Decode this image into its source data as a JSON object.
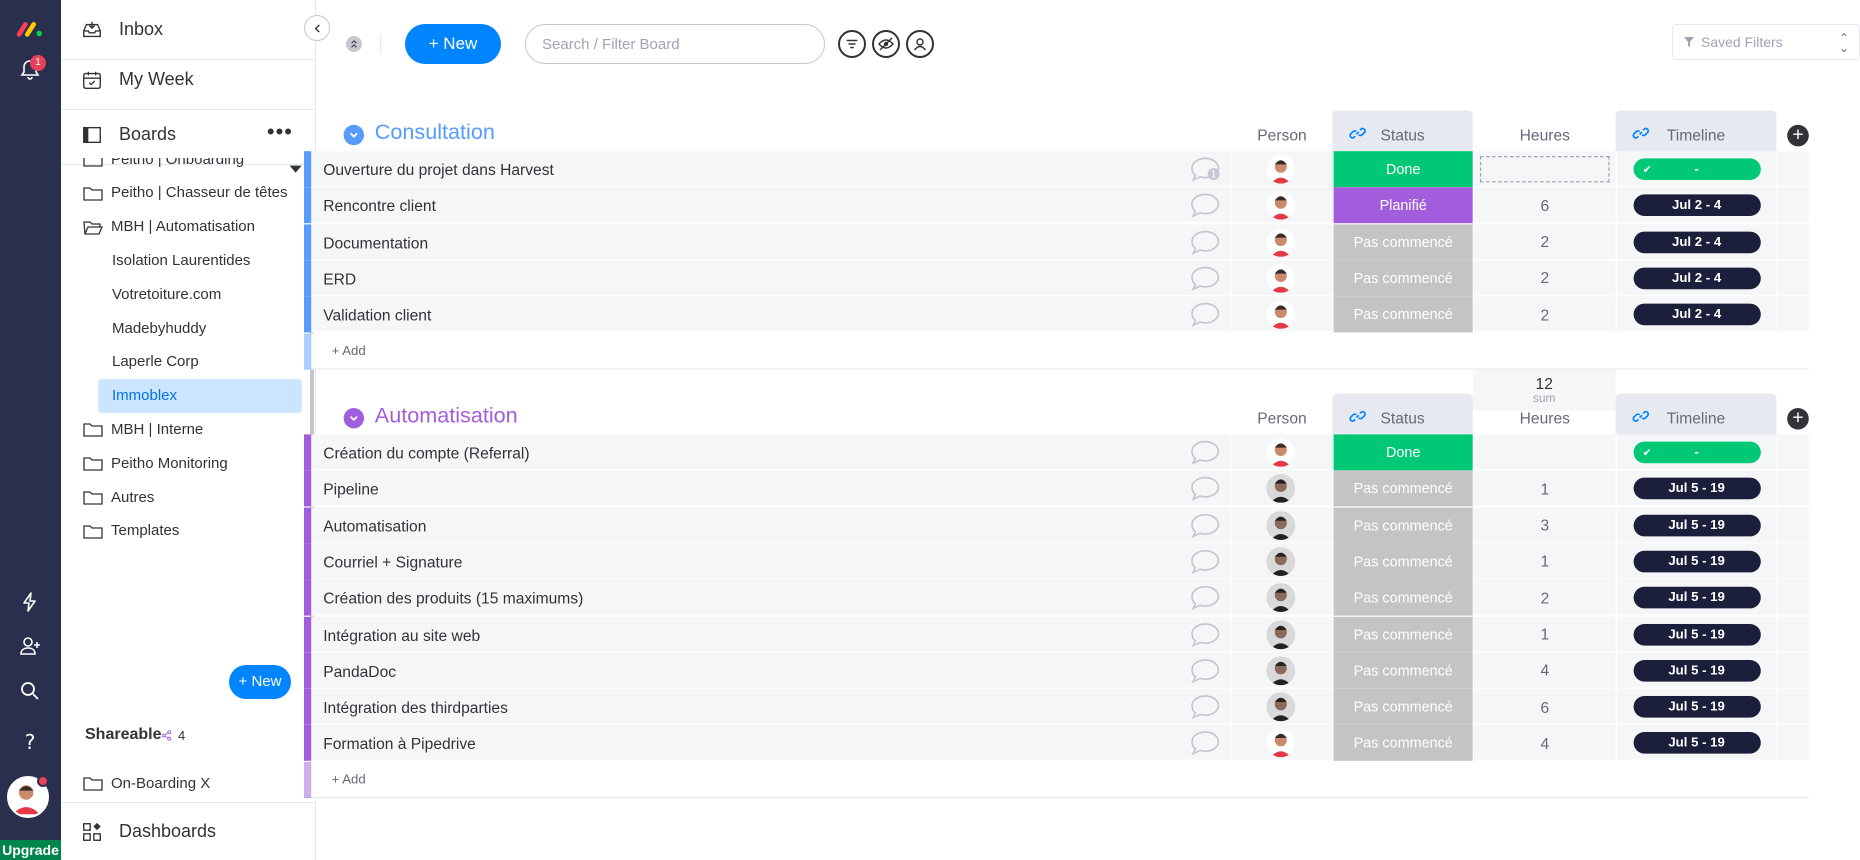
{
  "colors": {
    "consultation": "#579bfc",
    "automatisation": "#a25ddc",
    "done": "#00c875",
    "planifie": "#a25ddc",
    "pas_commence": "#c4c4c4"
  },
  "rail": {
    "notification_count": "1",
    "upgrade_label": "Upgrade"
  },
  "nav": {
    "inbox": "Inbox",
    "my_week": "My Week",
    "boards": "Boards",
    "boards_more": "•••",
    "board_items": [
      {
        "label": "Peitho | Onboarding",
        "type": "folder"
      },
      {
        "label": "Peitho | Chasseur de têtes",
        "type": "folder"
      },
      {
        "label": "MBH | Automatisation",
        "type": "folder-open"
      },
      {
        "label": "Isolation Laurentides",
        "type": "board"
      },
      {
        "label": "Votretoiture.com",
        "type": "board"
      },
      {
        "label": "Madebyhuddy",
        "type": "board"
      },
      {
        "label": "Laperle Corp",
        "type": "board"
      },
      {
        "label": "Immoblex",
        "type": "board-active"
      },
      {
        "label": "MBH | Interne",
        "type": "folder"
      },
      {
        "label": "Peitho Monitoring",
        "type": "folder"
      },
      {
        "label": "Autres",
        "type": "folder"
      },
      {
        "label": "Templates",
        "type": "folder"
      }
    ],
    "new_label": "+ New",
    "shareable_label": "Shareable",
    "shareable_count": "4",
    "onboarding_label": "On-Boarding X",
    "dashboards": "Dashboards"
  },
  "toolbar": {
    "new_label": "+ New",
    "search_placeholder": "Search / Filter Board",
    "saved_filters": "Saved Filters"
  },
  "columns": {
    "person": "Person",
    "status": "Status",
    "heures": "Heures",
    "timeline": "Timeline"
  },
  "groups": [
    {
      "title": "Consultation",
      "color_key": "consultation",
      "rows": [
        {
          "name": "Ouverture du projet dans Harvest",
          "status": "Done",
          "status_key": "done",
          "heures": "",
          "timeline": "-",
          "timeline_done": true,
          "avatar": "light",
          "chat_count": "1"
        },
        {
          "name": "Rencontre client",
          "status": "Planifié",
          "status_key": "planifie",
          "heures": "6",
          "timeline": "Jul 2 - 4",
          "timeline_done": false,
          "avatar": "light"
        },
        {
          "name": "Documentation",
          "status": "Pas commencé",
          "status_key": "pas_commence",
          "heures": "2",
          "timeline": "Jul 2 - 4",
          "timeline_done": false,
          "avatar": "light"
        },
        {
          "name": "ERD",
          "status": "Pas commencé",
          "status_key": "pas_commence",
          "heures": "2",
          "timeline": "Jul 2 - 4",
          "timeline_done": false,
          "avatar": "light"
        },
        {
          "name": "Validation client",
          "status": "Pas commencé",
          "status_key": "pas_commence",
          "heures": "2",
          "timeline": "Jul 2 - 4",
          "timeline_done": false,
          "avatar": "light"
        }
      ],
      "add_label": "+ Add",
      "sum_value": "12",
      "sum_label": "sum"
    },
    {
      "title": "Automatisation",
      "color_key": "automatisation",
      "rows": [
        {
          "name": "Création du compte (Referral)",
          "status": "Done",
          "status_key": "done",
          "heures": "",
          "timeline": "-",
          "timeline_done": true,
          "avatar": "light"
        },
        {
          "name": "Pipeline",
          "status": "Pas commencé",
          "status_key": "pas_commence",
          "heures": "1",
          "timeline": "Jul 5 - 19",
          "timeline_done": false,
          "avatar": "dark"
        },
        {
          "name": "Automatisation",
          "status": "Pas commencé",
          "status_key": "pas_commence",
          "heures": "3",
          "timeline": "Jul 5 - 19",
          "timeline_done": false,
          "avatar": "dark"
        },
        {
          "name": "Courriel + Signature",
          "status": "Pas commencé",
          "status_key": "pas_commence",
          "heures": "1",
          "timeline": "Jul 5 - 19",
          "timeline_done": false,
          "avatar": "dark"
        },
        {
          "name": "Création des produits (15 maximums)",
          "status": "Pas commencé",
          "status_key": "pas_commence",
          "heures": "2",
          "timeline": "Jul 5 - 19",
          "timeline_done": false,
          "avatar": "dark"
        },
        {
          "name": "Intégration au site web",
          "status": "Pas commencé",
          "status_key": "pas_commence",
          "heures": "1",
          "timeline": "Jul 5 - 19",
          "timeline_done": false,
          "avatar": "dark"
        },
        {
          "name": "PandaDoc",
          "status": "Pas commencé",
          "status_key": "pas_commence",
          "heures": "4",
          "timeline": "Jul 5 - 19",
          "timeline_done": false,
          "avatar": "dark"
        },
        {
          "name": "Intégration des thirdparties",
          "status": "Pas commencé",
          "status_key": "pas_commence",
          "heures": "6",
          "timeline": "Jul 5 - 19",
          "timeline_done": false,
          "avatar": "dark"
        },
        {
          "name": "Formation à Pipedrive",
          "status": "Pas commencé",
          "status_key": "pas_commence",
          "heures": "4",
          "timeline": "Jul 5 - 19",
          "timeline_done": false,
          "avatar": "light"
        }
      ],
      "add_label": "+ Add"
    }
  ]
}
